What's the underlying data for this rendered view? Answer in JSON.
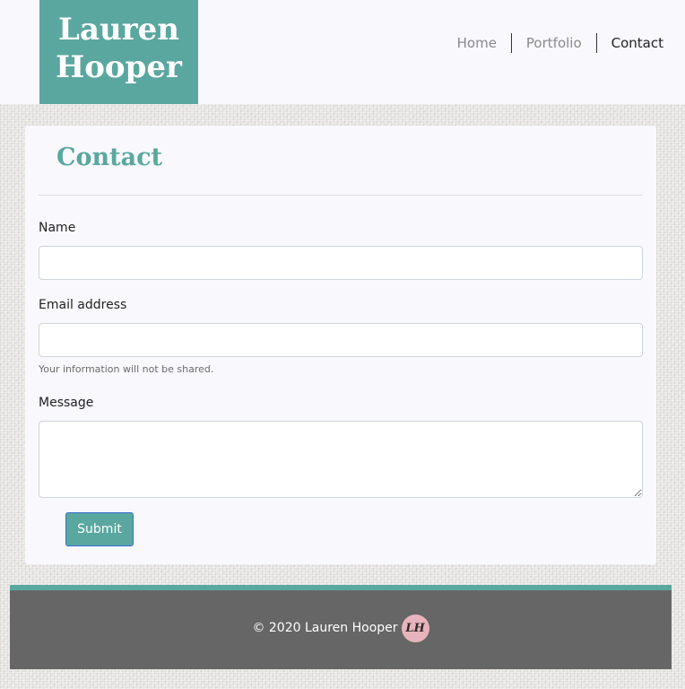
{
  "brand": {
    "line1": "Lauren",
    "line2": "Hooper"
  },
  "nav": {
    "items": [
      {
        "label": "Home",
        "active": false
      },
      {
        "label": "Portfolio",
        "active": false
      },
      {
        "label": "Contact",
        "active": true
      }
    ]
  },
  "contact": {
    "title": "Contact",
    "name_label": "Name",
    "name_value": "",
    "email_label": "Email address",
    "email_value": "",
    "email_help": "Your information will not be shared.",
    "message_label": "Message",
    "message_value": "",
    "submit_label": "Submit"
  },
  "footer": {
    "copyright": "© 2020 Lauren Hooper",
    "logo_text": "LH"
  },
  "colors": {
    "accent": "#5aa7a0",
    "footer_bg": "#666666",
    "logo_badge": "#e8b4bb",
    "panel_bg": "#f8f8fd"
  }
}
